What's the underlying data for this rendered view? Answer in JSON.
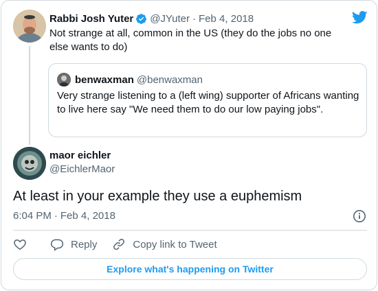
{
  "parent_tweet": {
    "author_name": "Rabbi Josh Yuter",
    "handle": "@JYuter",
    "date": "Feb 4, 2018",
    "separator": "·",
    "text": "Not strange at all, common in the US (they do the jobs no one else wants to do)"
  },
  "quoted_tweet": {
    "author_name": "benwaxman",
    "handle": "@benwaxman",
    "text": "Very strange listening to a (left wing) supporter of Africans wanting to live here say \"We need them to do our low paying jobs\"."
  },
  "main_tweet": {
    "author_name": "maor eichler",
    "handle": "@EichlerMaor",
    "text": "At least in your example they use a euphemism",
    "time": "6:04 PM",
    "separator": "·",
    "date": "Feb 4, 2018"
  },
  "actions": {
    "reply_label": "Reply",
    "copy_link_label": "Copy link to Tweet"
  },
  "explore_label": "Explore what's happening on Twitter",
  "colors": {
    "twitter_blue": "#1d9bf0",
    "text_primary": "#0f1419",
    "text_secondary": "#536471",
    "border": "#cfd9de"
  },
  "icons": [
    "verified-badge-icon",
    "twitter-bird-icon",
    "info-icon",
    "heart-icon",
    "reply-icon",
    "link-icon"
  ]
}
